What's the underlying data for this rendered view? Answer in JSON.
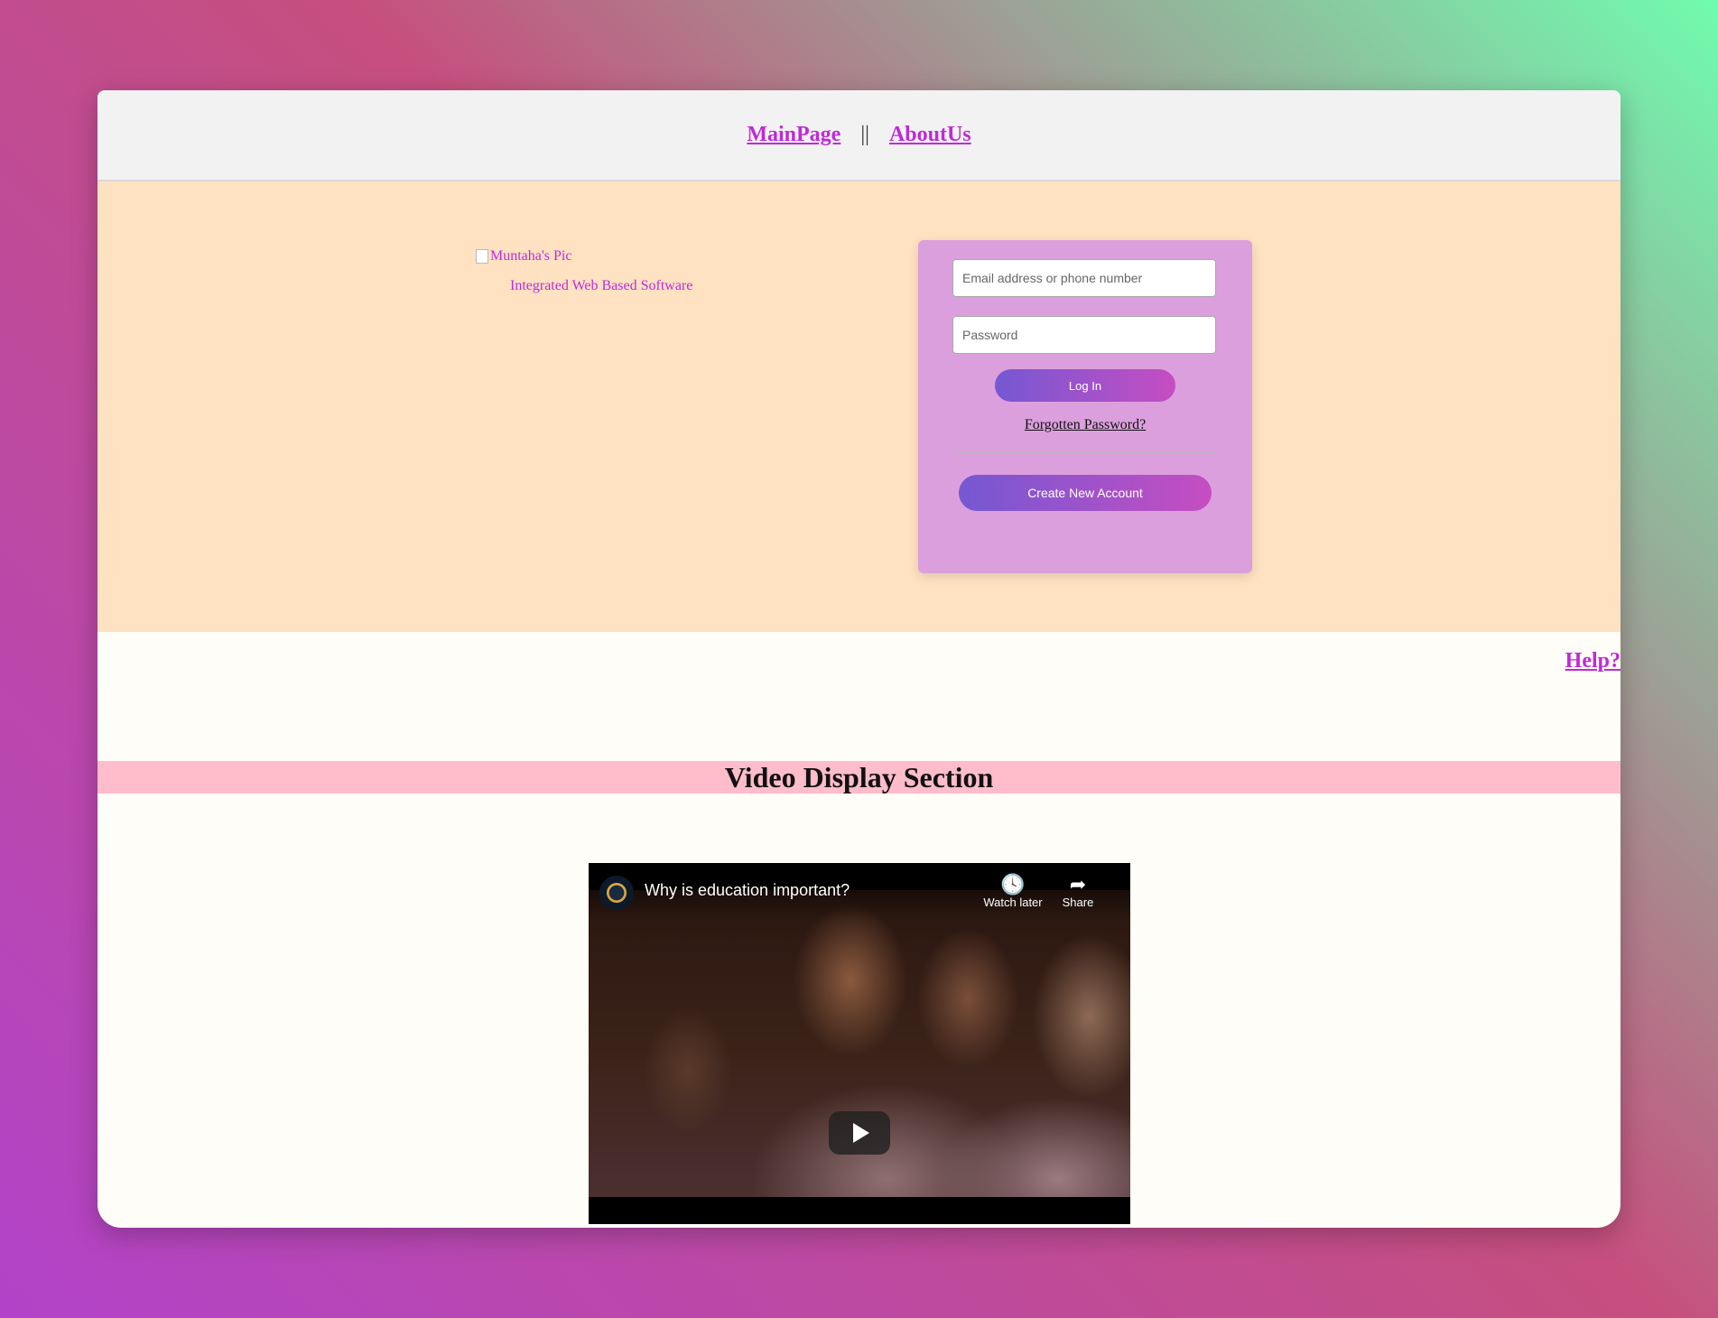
{
  "nav": {
    "main_page": "MainPage",
    "separator": "||",
    "about_us": "AboutUs"
  },
  "hero": {
    "brand_img_alt": "Muntaha's Pic",
    "tagline": "Integrated Web Based Software"
  },
  "login": {
    "email_placeholder": "Email address or phone number",
    "password_placeholder": "Password",
    "login_label": "Log In",
    "forgot_label": "Forgotten Password?",
    "create_label": "Create New Account"
  },
  "help": {
    "label": "Help?"
  },
  "video_section": {
    "heading": "Video Display Section",
    "title": "Why is education important?",
    "watch_later": "Watch later",
    "share": "Share"
  },
  "colors": {
    "link": "#c02ad8",
    "hero_bg": "#fee2c2",
    "login_card_bg": "#dc9fdd",
    "banner_bg": "#ffbccb",
    "button_gradient_start": "#7558d3",
    "button_gradient_end": "#c64dc1"
  }
}
